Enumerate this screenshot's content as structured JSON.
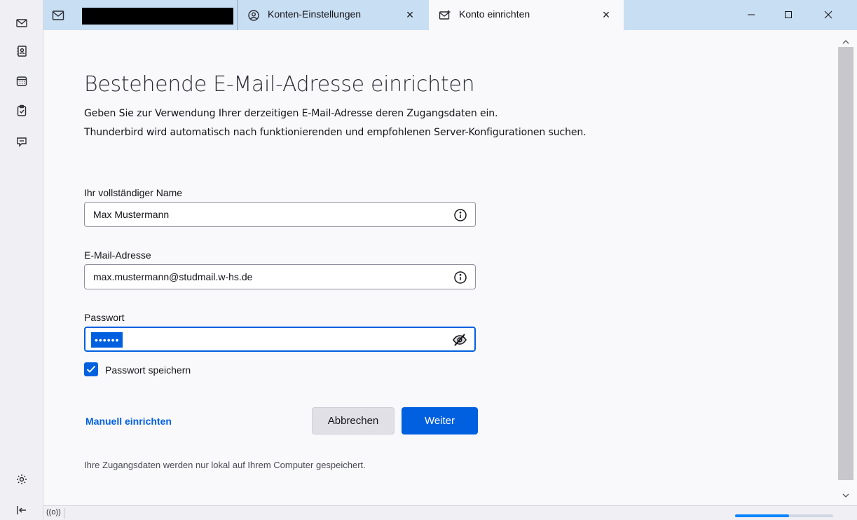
{
  "spaces": {
    "mail": "mail-icon",
    "addressbook": "address-book-icon",
    "calendar": "calendar-icon",
    "tasks": "tasks-icon",
    "chat": "chat-icon",
    "settings": "gear-icon",
    "collapse": "collapse-icon"
  },
  "tabs": [
    {
      "label": "",
      "redacted": true
    },
    {
      "label": "Konten-Einstellungen",
      "close": "×"
    },
    {
      "label": "Konto einrichten",
      "close": "×",
      "active": true
    }
  ],
  "window": {
    "minimize": "—",
    "maximize": "☐",
    "close": "✕"
  },
  "page": {
    "title": "Bestehende E-Mail-Adresse einrichten",
    "intro_line1": "Geben Sie zur Verwendung Ihrer derzeitigen E-Mail-Adresse deren Zugangsdaten ein.",
    "intro_line2": "Thunderbird wird automatisch nach funktionierenden und empfohlenen Server-Konfigurationen suchen."
  },
  "form": {
    "name_label": "Ihr vollständiger Name",
    "name_value": "Max Mustermann",
    "email_label": "E-Mail-Adresse",
    "email_value": "max.mustermann@studmail.w-hs.de",
    "password_label": "Passwort",
    "password_mask": "••••••",
    "remember_label": "Passwort speichern",
    "remember_checked": true
  },
  "actions": {
    "manual_link": "Manuell einrichten",
    "cancel_label": "Abbrechen",
    "next_label": "Weiter"
  },
  "footer_note": "Ihre Zugangsdaten werden nur lokal auf Ihrem Computer gespeichert.",
  "status": {
    "icon": "((o))",
    "progress_fraction": 0.55
  },
  "colors": {
    "accent": "#0060df",
    "tabbar": "#c8def2"
  }
}
